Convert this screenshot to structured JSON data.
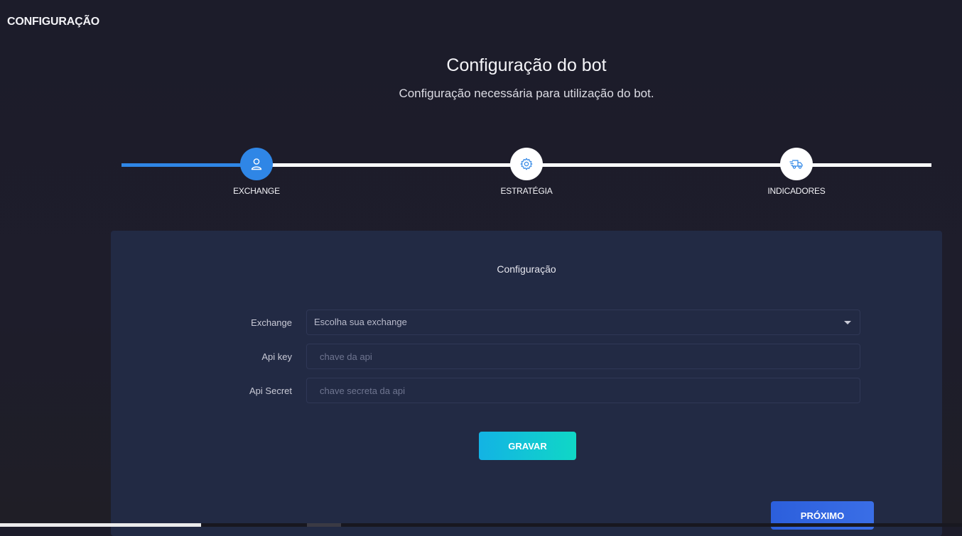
{
  "header": {
    "title": "CONFIGURAÇÃO"
  },
  "intro": {
    "title": "Configuração do bot",
    "subtitle": "Configuração necessária para utilização do bot."
  },
  "stepper": {
    "progress": 0.15,
    "steps": [
      {
        "label": "EXCHANGE",
        "icon": "user-icon",
        "active": true
      },
      {
        "label": "ESTRATÉGIA",
        "icon": "gear-icon",
        "active": false
      },
      {
        "label": "INDICADORES",
        "icon": "truck-icon",
        "active": false
      }
    ]
  },
  "panel": {
    "title": "Configuração",
    "exchange": {
      "label": "Exchange",
      "value": "Escolha sua exchange"
    },
    "api_key": {
      "label": "Api key",
      "placeholder": "chave da api"
    },
    "api_secret": {
      "label": "Api Secret",
      "placeholder": "chave secreta da api"
    },
    "save_label": "GRAVAR",
    "next_label": "PRÓXIMO"
  },
  "colors": {
    "accent": "#2f86e6",
    "panel_bg": "#222a44",
    "page_bg": "#1c1c2a"
  }
}
